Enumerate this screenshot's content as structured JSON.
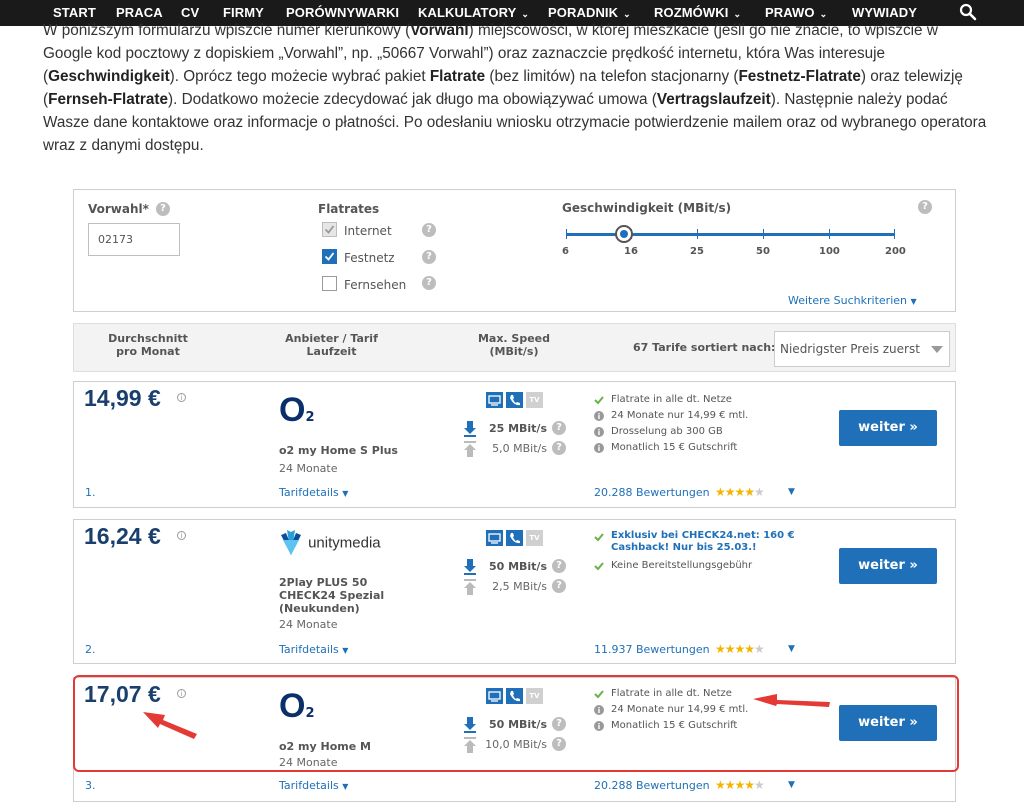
{
  "nav": {
    "items": [
      {
        "label": "START",
        "dropdown": false
      },
      {
        "label": "PRACA",
        "dropdown": false
      },
      {
        "label": "CV",
        "dropdown": false
      },
      {
        "label": "FIRMY",
        "dropdown": false
      },
      {
        "label": "PORÓWNYWARKI",
        "dropdown": false
      },
      {
        "label": "KALKULATORY",
        "dropdown": true
      },
      {
        "label": "PORADNIK",
        "dropdown": true
      },
      {
        "label": "ROZMÓWKI",
        "dropdown": true
      },
      {
        "label": "PRAWO",
        "dropdown": true
      },
      {
        "label": "WYWIADY",
        "dropdown": false
      }
    ],
    "dropdown_glyph": "⌄",
    "search_icon": "search-icon"
  },
  "article": {
    "p1": "W poniższym formularzu wpiszcie numer kierunkowy (",
    "b1": "Vorwahl",
    "p2": ") miejscowości, w której mieszkacie (jeśli go nie znacie, to wpiszcie w Google kod pocztowy z dopiskiem „Vorwahl”, np. „50667 Vorwahl”) oraz zaznaczcie prędkość internetu, która Was interesuje (",
    "b2": "Geschwindigkeit",
    "p3": "). Oprócz tego możecie wybrać pakiet ",
    "b3": "Flatrate",
    "p4": " (bez limitów) na telefon stacjonarny (",
    "b4": "Festnetz-Flatrate",
    "p5": ") oraz telewizję (",
    "b5": "Fernseh-Flatrate",
    "p6": "). Dodatkowo możecie zdecydować jak długo ma obowiązywać umowa (",
    "b6": "Vertragslaufzeit",
    "p7": "). Następnie należy podać Wasze dane kontaktowe oraz informacje o płatności. Po odesłaniu wniosku otrzymacie potwierdzenie mailem oraz od wybranego operatora wraz z danymi dostępu."
  },
  "filter": {
    "vorwahl_label": "Vorwahl*",
    "vorwahl_value": "02173",
    "flatrates_label": "Flatrates",
    "flatrates": [
      {
        "label": "Internet",
        "checked": true,
        "disabled": true
      },
      {
        "label": "Festnetz",
        "checked": true,
        "disabled": false
      },
      {
        "label": "Fernsehen",
        "checked": false,
        "disabled": false
      }
    ],
    "speed_label": "Geschwindigkeit (MBit/s)",
    "speed_ticks": [
      "6",
      "16",
      "25",
      "50",
      "100",
      "200"
    ],
    "speed_selected": "16",
    "more_criteria": "Weitere Suchkriterien",
    "help_glyph": "?"
  },
  "list_header": {
    "col_avg_1": "Durchschnitt",
    "col_avg_2": "pro Monat",
    "col_provider_1": "Anbieter / Tarif",
    "col_provider_2": "Laufzeit",
    "col_speed_1": "Max. Speed",
    "col_speed_2": "(MBit/s)",
    "sort_label": "67 Tarife sortiert nach:",
    "sort_value": "Niedrigster Preis zuerst"
  },
  "common": {
    "cta_label": "weiter »",
    "details_label": "Tarifdetails",
    "info_glyph": "i",
    "chevron_glyph": "▼",
    "tv_label": "TV"
  },
  "tariffs": [
    {
      "rank": "1.",
      "price": "14,99 €",
      "provider": "o2",
      "logo_text": "O",
      "logo_sub": "2",
      "name": "o2 my Home S Plus",
      "duration": "24 Monate",
      "down": "25 MBit/s",
      "up": "5,0 MBit/s",
      "features": [
        {
          "type": "check",
          "text": "Flatrate in alle dt. Netze"
        },
        {
          "type": "info",
          "text": "24 Monate nur 14,99 € mtl."
        },
        {
          "type": "info",
          "text": "Drosselung ab 300 GB"
        },
        {
          "type": "info",
          "text": "Monatlich 15 € Gutschrift"
        }
      ],
      "reviews": "20.288 Bewertungen",
      "rating": 3.5
    },
    {
      "rank": "2.",
      "price": "16,24 €",
      "provider": "unitymedia",
      "logo_text": "unitymedia",
      "name_lines": [
        "2Play PLUS 50",
        "CHECK24 Spezial",
        "(Neukunden)"
      ],
      "duration": "24 Monate",
      "down": "50 MBit/s",
      "up": "2,5 MBit/s",
      "promo": "Exklusiv bei CHECK24.net: 160 € Cashback! Nur bis 25.03.!",
      "features": [
        {
          "type": "check",
          "text": "Keine Bereitstellungsgebühr"
        }
      ],
      "reviews": "11.937 Bewertungen",
      "rating": 4
    },
    {
      "rank": "3.",
      "price": "17,07 €",
      "provider": "o2",
      "logo_text": "O",
      "logo_sub": "2",
      "name": "o2 my Home M",
      "duration": "24 Monate",
      "down": "50 MBit/s",
      "up": "10,0 MBit/s",
      "features": [
        {
          "type": "check",
          "text": "Flatrate in alle dt. Netze"
        },
        {
          "type": "info",
          "text": "24 Monate nur 14,99 € mtl."
        },
        {
          "type": "info",
          "text": "Monatlich 15 € Gutschrift"
        }
      ],
      "reviews": "20.288 Bewertungen",
      "rating": 3.5
    }
  ],
  "colors": {
    "accent": "#1f70b8",
    "price": "#1a3f6e",
    "annotation": "#e53935",
    "check": "#6ab04c",
    "star": "#f4b400"
  }
}
